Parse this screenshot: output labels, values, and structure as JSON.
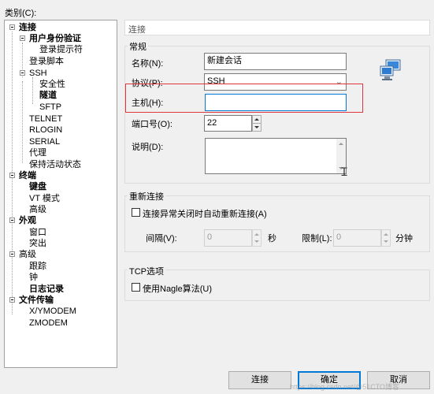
{
  "dialog": {
    "category_label": "类别(C):"
  },
  "tree": {
    "items": [
      {
        "label": "连接",
        "bold": true
      },
      {
        "label": "用户身份验证",
        "bold": true
      },
      {
        "label": "登录提示符",
        "bold": false
      },
      {
        "label": "登录脚本",
        "bold": false
      },
      {
        "label": "SSH",
        "bold": false
      },
      {
        "label": "安全性",
        "bold": false
      },
      {
        "label": "隧道",
        "bold": true
      },
      {
        "label": "SFTP",
        "bold": false
      },
      {
        "label": "TELNET",
        "bold": false
      },
      {
        "label": "RLOGIN",
        "bold": false
      },
      {
        "label": "SERIAL",
        "bold": false
      },
      {
        "label": "代理",
        "bold": false
      },
      {
        "label": "保持活动状态",
        "bold": false
      },
      {
        "label": "终端",
        "bold": true
      },
      {
        "label": "键盘",
        "bold": true
      },
      {
        "label": "VT 模式",
        "bold": false
      },
      {
        "label": "高级",
        "bold": false
      },
      {
        "label": "外观",
        "bold": true
      },
      {
        "label": "窗口",
        "bold": false
      },
      {
        "label": "突出",
        "bold": false
      },
      {
        "label": "高级",
        "bold": false
      },
      {
        "label": "跟踪",
        "bold": false
      },
      {
        "label": "钟",
        "bold": false
      },
      {
        "label": "日志记录",
        "bold": true
      },
      {
        "label": "文件传输",
        "bold": true
      },
      {
        "label": "X/YMODEM",
        "bold": false
      },
      {
        "label": "ZMODEM",
        "bold": false
      }
    ]
  },
  "panel": {
    "header": "连接"
  },
  "general": {
    "title": "常规",
    "name_label": "名称(N):",
    "name_value": "新建会话",
    "protocol_label": "协议(P):",
    "protocol_value": "SSH",
    "host_label": "主机(H):",
    "host_value": "",
    "port_label": "端口号(O):",
    "port_value": "22",
    "desc_label": "说明(D):",
    "desc_value": ""
  },
  "reconnect": {
    "title": "重新连接",
    "checkbox_label": "连接异常关闭时自动重新连接(A)",
    "interval_label": "间隔(V):",
    "interval_value": "0",
    "seconds_unit": "秒",
    "limit_label": "限制(L):",
    "limit_value": "0",
    "minutes_unit": "分钟"
  },
  "tcp": {
    "title": "TCP选项",
    "nagle_label": "使用Nagle算法(U)"
  },
  "buttons": {
    "connect": "连接",
    "ok": "确定",
    "cancel": "取消"
  },
  "watermark": "https://blog.csdn.net/@51CTO博客",
  "colors": {
    "highlight_box": "#e0353b",
    "focus_border": "#0078d7"
  }
}
